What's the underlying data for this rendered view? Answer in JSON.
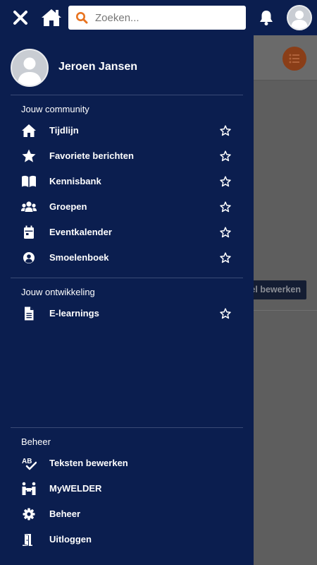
{
  "search": {
    "placeholder": "Zoeken..."
  },
  "profile": {
    "name": "Jeroen Jansen"
  },
  "sections": {
    "community": {
      "title": "Jouw community",
      "items": [
        {
          "label": "Tijdlijn",
          "icon": "home-icon"
        },
        {
          "label": "Favoriete berichten",
          "icon": "star-solid-icon"
        },
        {
          "label": "Kennisbank",
          "icon": "book-icon"
        },
        {
          "label": "Groepen",
          "icon": "users-icon"
        },
        {
          "label": "Eventkalender",
          "icon": "calendar-icon"
        },
        {
          "label": "Smoelenboek",
          "icon": "user-circle-icon"
        }
      ]
    },
    "ontwikkeling": {
      "title": "Jouw ontwikkeling",
      "items": [
        {
          "label": "E-learnings",
          "icon": "file-icon"
        }
      ]
    },
    "beheer": {
      "title": "Beheer",
      "items": [
        {
          "label": "Teksten bewerken",
          "icon": "spellcheck-icon"
        },
        {
          "label": "MyWELDER",
          "icon": "people-carry-icon"
        },
        {
          "label": "Beheer",
          "icon": "cog-icon"
        },
        {
          "label": "Uitloggen",
          "icon": "door-exit-icon"
        }
      ]
    }
  },
  "background": {
    "edit_button_label": "el bewerken"
  },
  "colors": {
    "navy": "#0b1e4f",
    "accent": "#e8731f"
  }
}
